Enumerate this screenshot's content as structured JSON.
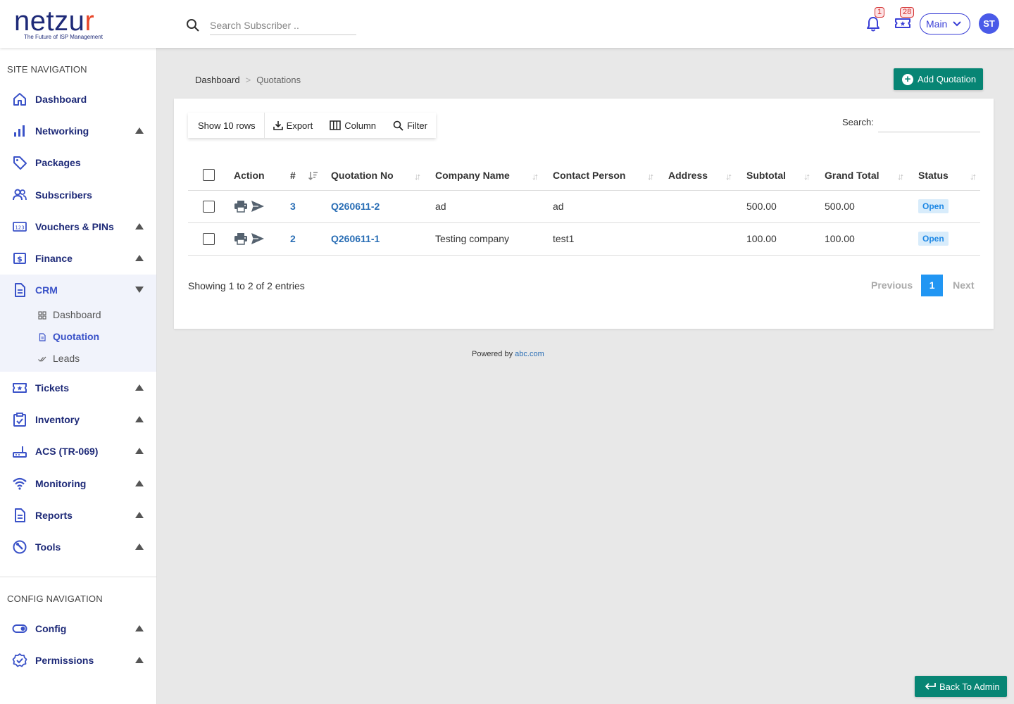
{
  "brand": {
    "name_main": "netzu",
    "name_accent": "r",
    "tagline": "The Future of ISP Management"
  },
  "header": {
    "search_placeholder": "Search Subscriber ..",
    "notifications_count": "1",
    "tickets_count": "28",
    "workspace": "Main",
    "user_initials": "ST"
  },
  "sidebar": {
    "site_title": "SITE NAVIGATION",
    "config_title": "CONFIG NAVIGATION",
    "items": [
      {
        "label": "Dashboard"
      },
      {
        "label": "Networking"
      },
      {
        "label": "Packages"
      },
      {
        "label": "Subscribers"
      },
      {
        "label": "Vouchers & PINs"
      },
      {
        "label": "Finance"
      },
      {
        "label": "CRM"
      },
      {
        "label": "Tickets"
      },
      {
        "label": "Inventory"
      },
      {
        "label": "ACS (TR-069)"
      },
      {
        "label": "Monitoring"
      },
      {
        "label": "Reports"
      },
      {
        "label": "Tools"
      }
    ],
    "crm_sub": [
      {
        "label": "Dashboard"
      },
      {
        "label": "Quotation"
      },
      {
        "label": "Leads"
      }
    ],
    "config_items": [
      {
        "label": "Config"
      },
      {
        "label": "Permissions"
      }
    ]
  },
  "breadcrumb": {
    "root": "Dashboard",
    "sep": ">",
    "current": "Quotations"
  },
  "add_button": "Add Quotation",
  "toolbar": {
    "rows": "Show 10 rows",
    "export": "Export",
    "column": "Column",
    "filter": "Filter",
    "search_label": "Search:"
  },
  "table": {
    "headers": [
      "Action",
      "#",
      "Quotation No",
      "Company Name",
      "Contact Person",
      "Address",
      "Subtotal",
      "Grand Total",
      "Status"
    ],
    "rows": [
      {
        "num": "3",
        "quotation_no": "Q260611-2",
        "company": "ad",
        "contact": "ad",
        "address": "",
        "subtotal": "500.00",
        "grand_total": "500.00",
        "status": "Open"
      },
      {
        "num": "2",
        "quotation_no": "Q260611-1",
        "company": "Testing company",
        "contact": "test1",
        "address": "",
        "subtotal": "100.00",
        "grand_total": "100.00",
        "status": "Open"
      }
    ]
  },
  "summary": "Showing 1 to 2 of 2 entries",
  "pagination": {
    "previous": "Previous",
    "current": "1",
    "next": "Next"
  },
  "footer": {
    "text": "Powered by",
    "link": "abc.com"
  },
  "back_button": "Back To Admin",
  "colors": {
    "primary": "#1e2a78",
    "accent": "#078574",
    "link": "#2a6eb5",
    "page_active": "#2196f3",
    "logo_accent": "#e8472a"
  }
}
